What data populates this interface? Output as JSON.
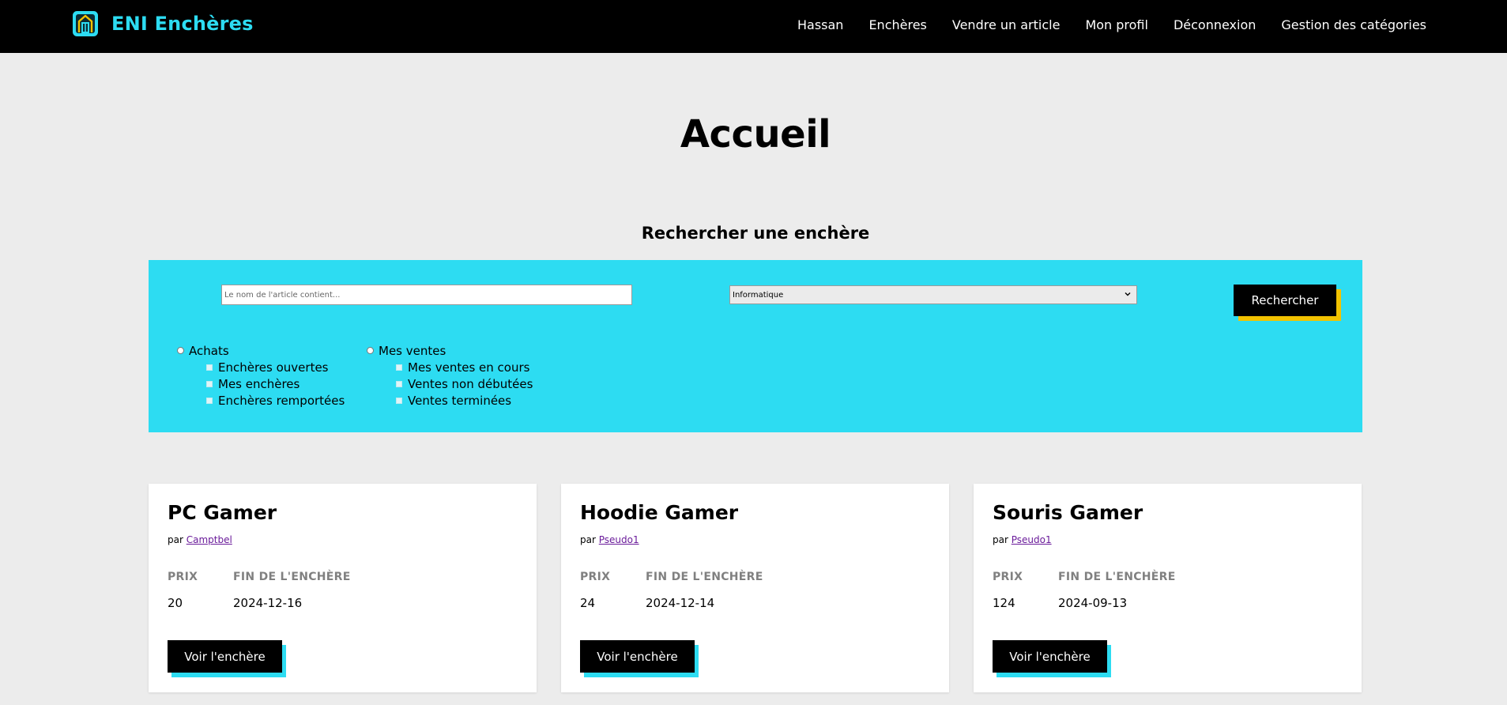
{
  "header": {
    "brand": "ENI Enchères",
    "logo_icon": "home-window-icon",
    "nav": [
      "Hassan",
      "Enchères",
      "Vendre un article",
      "Mon profil",
      "Déconnexion",
      "Gestion des catégories"
    ]
  },
  "page_title": "Accueil",
  "search": {
    "title": "Rechercher une enchère",
    "placeholder": "Le nom de l'article contient...",
    "value": "",
    "category_selected": "Informatique",
    "button": "Rechercher"
  },
  "filters": {
    "achats": {
      "label": "Achats",
      "options": [
        "Enchères ouvertes",
        "Mes enchères",
        "Enchères remportées"
      ]
    },
    "ventes": {
      "label": "Mes ventes",
      "options": [
        "Mes ventes en cours",
        "Ventes non débutées",
        "Ventes terminées"
      ]
    }
  },
  "card_labels": {
    "seller_prefix": "par",
    "price": "PRIX",
    "end": "FIN DE L'ENCHÈRE",
    "button": "Voir l'enchère"
  },
  "cards": [
    {
      "title": "PC Gamer",
      "seller": "Camptbel",
      "price": "20",
      "end_date": "2024-12-16"
    },
    {
      "title": "Hoodie Gamer",
      "seller": "Pseudo1",
      "price": "24",
      "end_date": "2024-12-14"
    },
    {
      "title": "Souris Gamer",
      "seller": "Pseudo1",
      "price": "124",
      "end_date": "2024-09-13"
    }
  ],
  "colors": {
    "accent": "#2ddcf2",
    "button_shadow_yellow": "#f2c200",
    "header_bg": "#000000",
    "page_bg": "#ececec"
  }
}
